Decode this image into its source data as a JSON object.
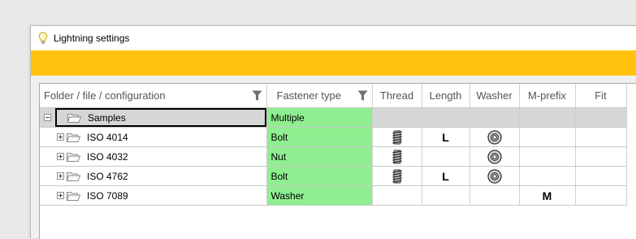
{
  "window": {
    "title": "Lightning settings"
  },
  "grid": {
    "columns": [
      "Folder / file / configuration",
      "Fastener type",
      "Thread",
      "Length",
      "Washer",
      "M-prefix",
      "Fit"
    ],
    "group_row": {
      "name": "Samples",
      "fastener_type": "Multiple"
    },
    "rows": [
      {
        "name": "ISO 4014",
        "fastener_type": "Bolt",
        "thread": true,
        "length": "L",
        "washer": true,
        "m_prefix": ""
      },
      {
        "name": "ISO 4032",
        "fastener_type": "Nut",
        "thread": true,
        "length": "",
        "washer": true,
        "m_prefix": ""
      },
      {
        "name": "ISO 4762",
        "fastener_type": "Bolt",
        "thread": true,
        "length": "L",
        "washer": true,
        "m_prefix": ""
      },
      {
        "name": "ISO 7089",
        "fastener_type": "Washer",
        "thread": false,
        "length": "",
        "washer": false,
        "m_prefix": "M"
      }
    ]
  },
  "colors": {
    "accent": "#ffc20e",
    "fastener_type_cell": "#90ee90",
    "group_row": "#d6d6d6"
  }
}
